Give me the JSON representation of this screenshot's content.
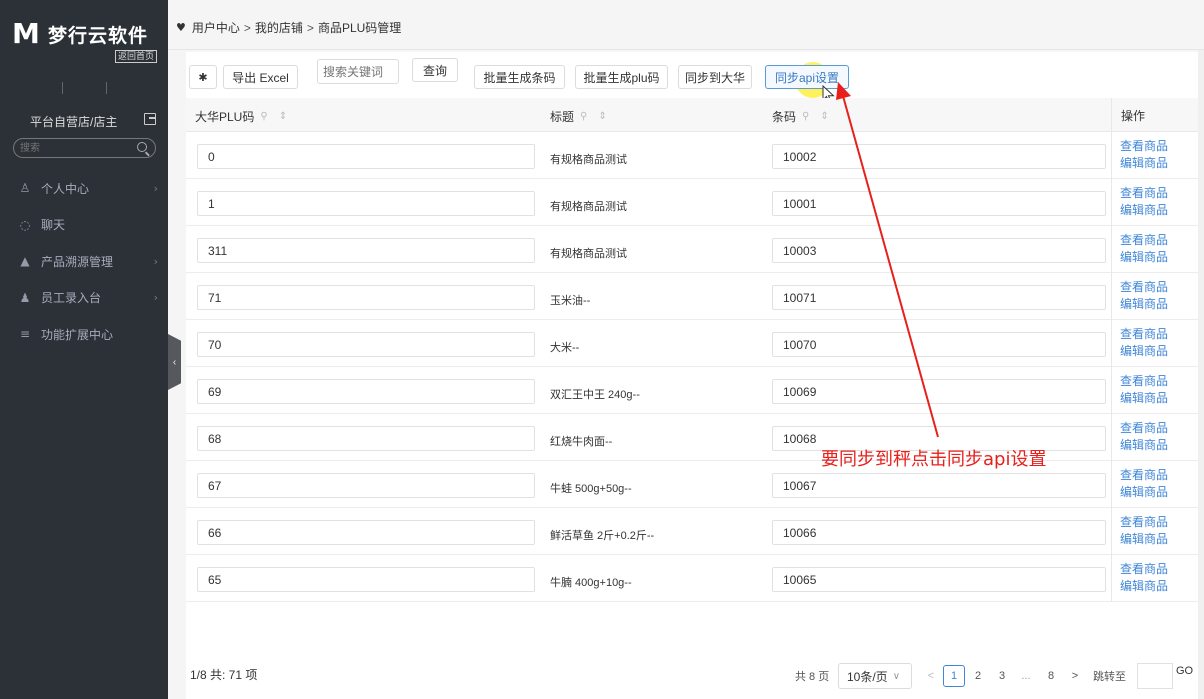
{
  "app": {
    "logo_mark": "M",
    "logo_text": "梦行云软件",
    "back_home": "返回首页"
  },
  "sidebar": {
    "shop_role": "平台自营店/店主",
    "search_placeholder": "搜索",
    "items": [
      {
        "label": "个人中心",
        "icon": "person-icon",
        "glyph": "♙",
        "has_children": true
      },
      {
        "label": "聊天",
        "icon": "chat-icon",
        "glyph": "◌",
        "has_children": false
      },
      {
        "label": "产品溯源管理",
        "icon": "box-icon",
        "glyph": "▲",
        "has_children": true
      },
      {
        "label": "员工录入台",
        "icon": "staff-icon",
        "glyph": "♟",
        "has_children": true
      },
      {
        "label": "功能扩展中心",
        "icon": "menu-lines-icon",
        "glyph": "≡",
        "has_children": false
      }
    ],
    "chevron": "›",
    "collapse": "‹"
  },
  "breadcrumb": {
    "items": [
      "用户中心",
      "我的店铺",
      "商品PLU码管理"
    ],
    "separator": ">"
  },
  "toolbar": {
    "settings_glyph": "✱",
    "export_label": "导出 Excel",
    "search_placeholder": "搜索关键词",
    "query_label": "查询",
    "batch_barcode_label": "批量生成条码",
    "batch_plu_label": "批量生成plu码",
    "sync_dahua_label": "同步到大华",
    "sync_api_label": "同步api设置"
  },
  "table": {
    "columns": {
      "plu": "大华PLU码",
      "title": "标题",
      "barcode": "条码",
      "ops": "操作"
    },
    "col_tools": "⚲ ⇕",
    "rows": [
      {
        "plu": "0",
        "title": "有规格商品测试",
        "barcode": "10002"
      },
      {
        "plu": "1",
        "title": "有规格商品测试",
        "barcode": "10001"
      },
      {
        "plu": "311",
        "title": "有规格商品测试",
        "barcode": "10003"
      },
      {
        "plu": "71",
        "title": "玉米油--",
        "barcode": "10071"
      },
      {
        "plu": "70",
        "title": "大米--",
        "barcode": "10070"
      },
      {
        "plu": "69",
        "title": "双汇王中王 240g--",
        "barcode": "10069"
      },
      {
        "plu": "68",
        "title": "红烧牛肉面--",
        "barcode": "10068"
      },
      {
        "plu": "67",
        "title": "牛蛙 500g+50g--",
        "barcode": "10067"
      },
      {
        "plu": "66",
        "title": "鲜活草鱼 2斤+0.2斤--",
        "barcode": "10066"
      },
      {
        "plu": "65",
        "title": "牛腩 400g+10g--",
        "barcode": "10065"
      }
    ],
    "view_label": "查看商品",
    "edit_label": "编辑商品"
  },
  "footer": {
    "info": "1/8 共: 71 项",
    "total_pages": "共 8 页",
    "page_size": "10条/页",
    "dropdown_glyph": "∨",
    "prev": "<",
    "next": ">",
    "pages": [
      "1",
      "2",
      "3",
      "...",
      "8"
    ],
    "current_page": "1",
    "jump_label": "跳转至",
    "go": "GO"
  },
  "annotation": {
    "text": "要同步到秤点击同步api设置",
    "color": "#e8201c"
  }
}
